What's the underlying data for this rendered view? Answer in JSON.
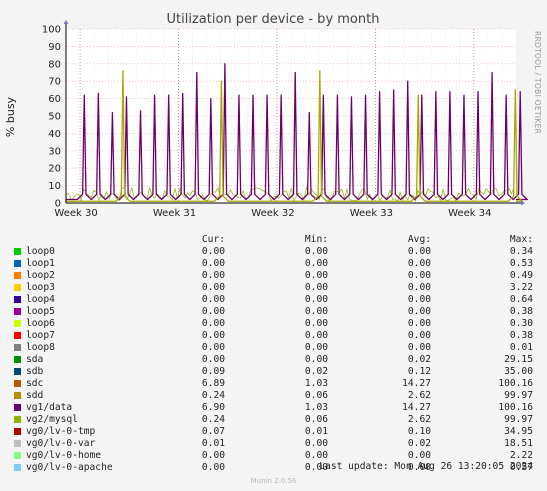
{
  "side_label": "RRDTOOL / TOBI OETIKER",
  "chart_data": {
    "type": "line",
    "title": "Utilization per device - by month",
    "ylabel": "% busy",
    "ylim": [
      0,
      100
    ],
    "yticks": [
      0,
      10,
      20,
      30,
      40,
      50,
      60,
      70,
      80,
      90,
      100
    ],
    "x_ticks": [
      "Week 30",
      "Week 31",
      "Week 32",
      "Week 33",
      "Week 34"
    ],
    "x_range_days": [
      0,
      32
    ],
    "x_tick_days": [
      1,
      8,
      15,
      22,
      29
    ],
    "grid": true,
    "series": [
      {
        "name": "vg1/data",
        "color": "#6b006b",
        "peaks": [
          [
            1.3,
            62
          ],
          [
            2.3,
            63
          ],
          [
            3.3,
            52
          ],
          [
            4.3,
            61
          ],
          [
            5.3,
            53
          ],
          [
            6.3,
            62
          ],
          [
            7.3,
            62
          ],
          [
            8.3,
            63
          ],
          [
            9.3,
            75
          ],
          [
            10.3,
            60
          ],
          [
            11.3,
            80
          ],
          [
            12.3,
            62
          ],
          [
            13.3,
            62
          ],
          [
            14.3,
            62
          ],
          [
            15.3,
            62
          ],
          [
            16.3,
            75
          ],
          [
            17.3,
            52
          ],
          [
            18.3,
            62
          ],
          [
            19.3,
            62
          ],
          [
            20.3,
            61
          ],
          [
            21.3,
            62
          ],
          [
            22.3,
            64
          ],
          [
            23.3,
            65
          ],
          [
            24.3,
            70
          ],
          [
            25.3,
            62
          ],
          [
            26.3,
            64
          ],
          [
            27.3,
            64
          ],
          [
            28.3,
            62
          ],
          [
            29.3,
            64
          ],
          [
            30.3,
            75
          ],
          [
            31.3,
            62
          ],
          [
            32.3,
            64
          ]
        ]
      },
      {
        "name": "vg2/mysql",
        "color": "#a8a800",
        "peaks": [
          [
            4.05,
            76
          ],
          [
            11.05,
            70
          ],
          [
            18.05,
            76
          ],
          [
            25.05,
            62
          ],
          [
            31.95,
            65
          ]
        ]
      }
    ],
    "legend_columns": [
      "Cur:",
      "Min:",
      "Avg:",
      "Max:"
    ],
    "legend": [
      {
        "name": "loop0",
        "color": "#00cc00",
        "cur": "0.00",
        "min": "0.00",
        "avg": "0.00",
        "max": "0.34"
      },
      {
        "name": "loop1",
        "color": "#0066b3",
        "cur": "0.00",
        "min": "0.00",
        "avg": "0.00",
        "max": "0.53"
      },
      {
        "name": "loop2",
        "color": "#ff8000",
        "cur": "0.00",
        "min": "0.00",
        "avg": "0.00",
        "max": "0.49"
      },
      {
        "name": "loop3",
        "color": "#ffcc00",
        "cur": "0.00",
        "min": "0.00",
        "avg": "0.00",
        "max": "3.22"
      },
      {
        "name": "loop4",
        "color": "#330099",
        "cur": "0.00",
        "min": "0.00",
        "avg": "0.00",
        "max": "0.64"
      },
      {
        "name": "loop5",
        "color": "#990099",
        "cur": "0.00",
        "min": "0.00",
        "avg": "0.00",
        "max": "0.38"
      },
      {
        "name": "loop6",
        "color": "#ccff00",
        "cur": "0.00",
        "min": "0.00",
        "avg": "0.00",
        "max": "0.30"
      },
      {
        "name": "loop7",
        "color": "#ff0000",
        "cur": "0.00",
        "min": "0.00",
        "avg": "0.00",
        "max": "0.38"
      },
      {
        "name": "loop8",
        "color": "#808080",
        "cur": "0.00",
        "min": "0.00",
        "avg": "0.00",
        "max": "0.01"
      },
      {
        "name": "sda",
        "color": "#008f00",
        "cur": "0.00",
        "min": "0.00",
        "avg": "0.02",
        "max": "29.15"
      },
      {
        "name": "sdb",
        "color": "#00487d",
        "cur": "0.09",
        "min": "0.02",
        "avg": "0.12",
        "max": "35.00"
      },
      {
        "name": "sdc",
        "color": "#b35a00",
        "cur": "6.89",
        "min": "1.03",
        "avg": "14.27",
        "max": "100.16"
      },
      {
        "name": "sdd",
        "color": "#b38f00",
        "cur": "0.24",
        "min": "0.06",
        "avg": "2.62",
        "max": "99.97"
      },
      {
        "name": "vg1/data",
        "color": "#6b006b",
        "cur": "6.90",
        "min": "1.03",
        "avg": "14.27",
        "max": "100.16"
      },
      {
        "name": "vg2/mysql",
        "color": "#8fb300",
        "cur": "0.24",
        "min": "0.06",
        "avg": "2.62",
        "max": "99.97"
      },
      {
        "name": "vg0/lv-0-tmp",
        "color": "#b30000",
        "cur": "0.07",
        "min": "0.01",
        "avg": "0.10",
        "max": "34.95"
      },
      {
        "name": "vg0/lv-0-var",
        "color": "#bebebe",
        "cur": "0.01",
        "min": "0.00",
        "avg": "0.02",
        "max": "18.51"
      },
      {
        "name": "vg0/lv-0-home",
        "color": "#80ff80",
        "cur": "0.00",
        "min": "0.00",
        "avg": "0.00",
        "max": "2.22"
      },
      {
        "name": "vg0/lv-0-apache",
        "color": "#80c9ff",
        "cur": "0.00",
        "min": "0.00",
        "avg": "0.00",
        "max": "0.57"
      }
    ]
  },
  "footer": {
    "last_update": "Last update: Mon Aug 26 13:20:05 2024",
    "munin": "Munin 2.0.56"
  }
}
